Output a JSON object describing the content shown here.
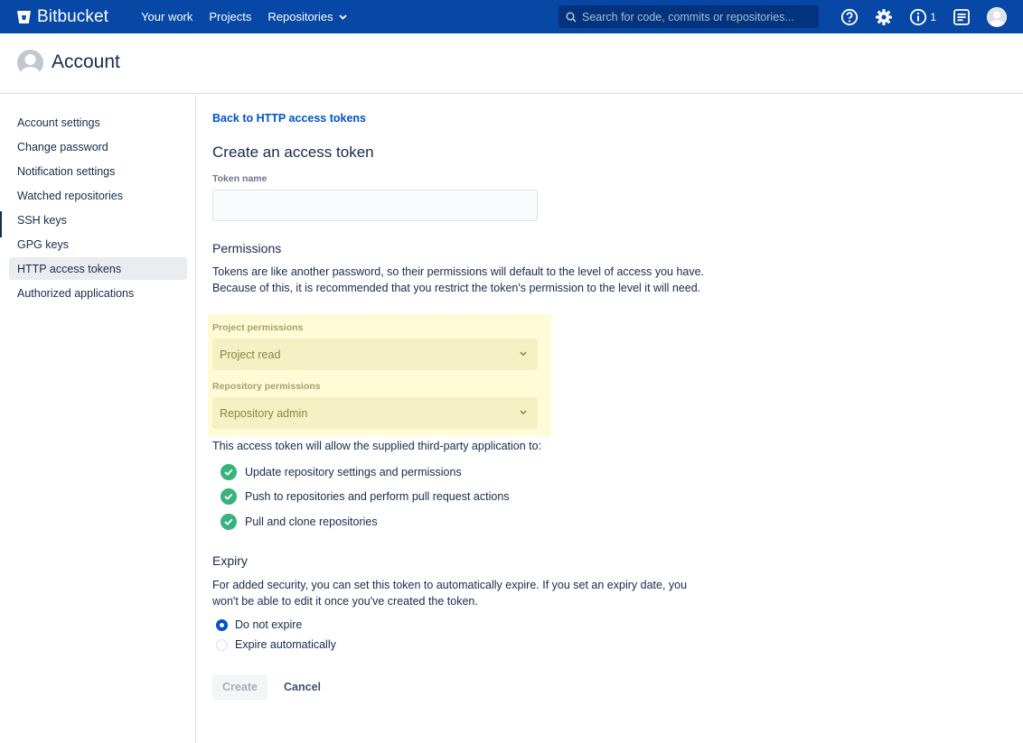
{
  "nav": {
    "brand": "Bitbucket",
    "links": [
      "Your work",
      "Projects",
      "Repositories"
    ],
    "search_placeholder": "Search for code, commits or repositories...",
    "notification_count": "1"
  },
  "header": {
    "title": "Account"
  },
  "sidebar": {
    "items": [
      "Account settings",
      "Change password",
      "Notification settings",
      "Watched repositories",
      "SSH keys",
      "GPG keys",
      "HTTP access tokens",
      "Authorized applications"
    ],
    "active_index": 6
  },
  "main": {
    "back_link": "Back to HTTP access tokens",
    "title": "Create an access token",
    "token_name_label": "Token name",
    "token_name_value": "",
    "permissions_title": "Permissions",
    "permissions_text": "Tokens are like another password, so their permissions will default to the level of access you have. Because of this, it is recommended that you restrict the token's permission to the level it will need.",
    "project_permissions_label": "Project permissions",
    "project_permissions_value": "Project read",
    "repository_permissions_label": "Repository permissions",
    "repository_permissions_value": "Repository admin",
    "allow_text": "This access token will allow the supplied third-party application to:",
    "allowed": [
      "Update repository settings and permissions",
      "Push to repositories and perform pull request actions",
      "Pull and clone repositories"
    ],
    "expiry_title": "Expiry",
    "expiry_text": "For added security, you can set this token to automatically expire. If you set an expiry date, you won't be able to edit it once you've created the token.",
    "expiry_options": [
      "Do not expire",
      "Expire automatically"
    ],
    "expiry_selected": 0,
    "create_label": "Create",
    "cancel_label": "Cancel"
  },
  "colors": {
    "nav_bg": "#0747a6",
    "link": "#0052cc",
    "success": "#36b37e",
    "highlight": "#fffbd6"
  }
}
